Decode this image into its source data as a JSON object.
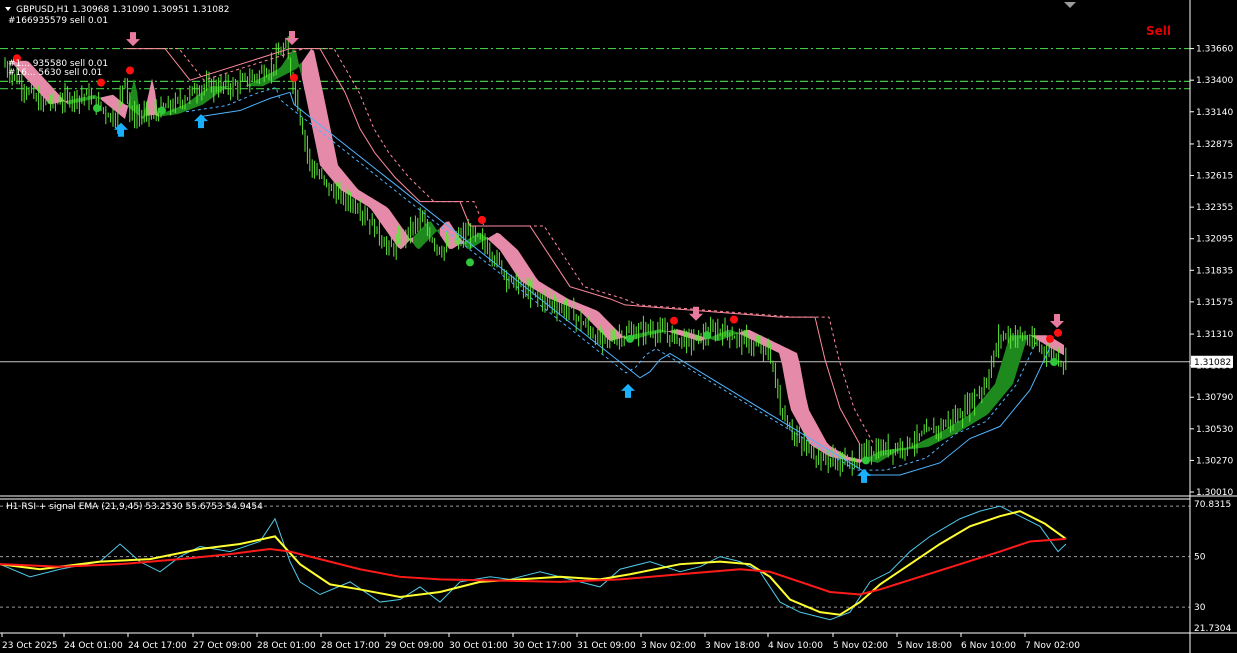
{
  "header": {
    "symbol_line": "GBPUSD,H1  1.30968 1.31090 1.30951 1.31082",
    "order_labels": [
      "#166935579 sell 0.01",
      "#1... 935580 sell 0.01",
      "#16... 5630 sell 0.01"
    ],
    "signal_text": "Sell"
  },
  "rsi_header": "H1 RSI + signal EMA (21,9,45) 53.2530 55.6753 54.9454",
  "colors": {
    "background": "#000000",
    "candle": "#5ee83a",
    "ribbon_down": "#e58aa8",
    "ribbon_up": "#1e8a1e",
    "stop_line": "#ff8ba0",
    "support_line": "#4fb4ff",
    "arrow_up": "#19b0ff",
    "arrow_down": "#e87aa0",
    "dot_red": "#ff1010",
    "dot_green": "#2ec83a",
    "dashdot": "#43c843",
    "rsi_line": "#4fc8e8",
    "rsi_signal": "#ffff30",
    "rsi_slow": "#ff1a1a",
    "current_price_line": "#c8c8c8"
  },
  "chart_data": [
    {
      "type": "candlestick",
      "title": "GBPUSD,H1",
      "ylim": [
        1.3001,
        1.3392
      ],
      "y_ticks": [
        "1.33660",
        "1.33400",
        "1.33140",
        "1.32875",
        "1.32615",
        "1.32355",
        "1.32095",
        "1.31835",
        "1.31575",
        "1.31310",
        "1.31050",
        "1.30790",
        "1.30530",
        "1.30270",
        "1.30010"
      ],
      "current_price": "1.31082",
      "x_ticks": [
        "23 Oct 2025",
        "24 Oct 01:00",
        "24 Oct 17:00",
        "27 Oct 09:00",
        "28 Oct 01:00",
        "28 Oct 17:00",
        "29 Oct 09:00",
        "30 Oct 01:00",
        "30 Oct 17:00",
        "31 Oct 09:00",
        "3 Nov 02:00",
        "3 Nov 18:00",
        "4 Nov 10:00",
        "5 Nov 02:00",
        "5 Nov 18:00",
        "6 Nov 10:00",
        "7 Nov 02:00"
      ],
      "close_path": [
        [
          0,
          1.3356
        ],
        [
          40,
          1.332
        ],
        [
          85,
          1.3328
        ],
        [
          115,
          1.3308
        ],
        [
          125,
          1.3345
        ],
        [
          130,
          1.331
        ],
        [
          150,
          1.3312
        ],
        [
          175,
          1.332
        ],
        [
          200,
          1.3335
        ],
        [
          235,
          1.3335
        ],
        [
          270,
          1.335
        ],
        [
          285,
          1.3368
        ],
        [
          295,
          1.333
        ],
        [
          310,
          1.327
        ],
        [
          330,
          1.325
        ],
        [
          360,
          1.3235
        ],
        [
          390,
          1.32
        ],
        [
          420,
          1.3225
        ],
        [
          440,
          1.32
        ],
        [
          470,
          1.3215
        ],
        [
          490,
          1.32
        ],
        [
          510,
          1.3175
        ],
        [
          540,
          1.316
        ],
        [
          570,
          1.315
        ],
        [
          600,
          1.3125
        ],
        [
          620,
          1.313
        ],
        [
          650,
          1.3135
        ],
        [
          690,
          1.3125
        ],
        [
          720,
          1.3135
        ],
        [
          745,
          1.3125
        ],
        [
          770,
          1.3115
        ],
        [
          780,
          1.307
        ],
        [
          800,
          1.304
        ],
        [
          820,
          1.303
        ],
        [
          850,
          1.3025
        ],
        [
          870,
          1.3035
        ],
        [
          900,
          1.3038
        ],
        [
          930,
          1.305
        ],
        [
          960,
          1.3065
        ],
        [
          985,
          1.309
        ],
        [
          1000,
          1.313
        ],
        [
          1020,
          1.313
        ],
        [
          1040,
          1.312
        ],
        [
          1066,
          1.3108
        ]
      ],
      "resistance_path": [
        [
          125,
          1.3366
        ],
        [
          165,
          1.3366
        ],
        [
          190,
          1.334
        ],
        [
          290,
          1.3366
        ],
        [
          320,
          1.3366
        ],
        [
          345,
          1.333
        ],
        [
          360,
          1.33
        ],
        [
          375,
          1.328
        ],
        [
          395,
          1.326
        ],
        [
          420,
          1.324
        ],
        [
          460,
          1.324
        ],
        [
          470,
          1.322
        ],
        [
          530,
          1.322
        ],
        [
          550,
          1.3195
        ],
        [
          570,
          1.317
        ],
        [
          610,
          1.316
        ],
        [
          625,
          1.3155
        ],
        [
          780,
          1.3145
        ],
        [
          815,
          1.3145
        ],
        [
          825,
          1.311
        ],
        [
          840,
          1.307
        ],
        [
          860,
          1.304
        ]
      ],
      "support_path": [
        [
          200,
          1.331
        ],
        [
          240,
          1.3315
        ],
        [
          270,
          1.3325
        ],
        [
          290,
          1.333
        ],
        [
          294,
          1.332
        ],
        [
          640,
          1.3095
        ],
        [
          650,
          1.31
        ],
        [
          660,
          1.311
        ],
        [
          670,
          1.3115
        ],
        [
          870,
          1.3015
        ],
        [
          900,
          1.3015
        ],
        [
          940,
          1.3025
        ],
        [
          970,
          1.3045
        ],
        [
          1000,
          1.3055
        ],
        [
          1030,
          1.3085
        ],
        [
          1050,
          1.312
        ]
      ],
      "signals": {
        "arrows_up": [
          [
            121,
            1.3305
          ],
          [
            201,
            1.3312
          ],
          [
            628,
            1.309
          ],
          [
            864,
            1.302
          ]
        ],
        "arrows_down": [
          [
            133,
            1.3368
          ],
          [
            292,
            1.3369
          ],
          [
            696,
            1.3142
          ],
          [
            1057,
            1.3136
          ]
        ],
        "dots_red": [
          [
            17,
            1.3358
          ],
          [
            101,
            1.3338
          ],
          [
            130,
            1.3348
          ],
          [
            294,
            1.3342
          ],
          [
            482,
            1.3225
          ],
          [
            674,
            1.3142
          ],
          [
            734,
            1.3143
          ],
          [
            1050,
            1.3127
          ],
          [
            1058,
            1.3132
          ]
        ],
        "dots_green": [
          [
            97,
            1.3317
          ],
          [
            162,
            1.3315
          ],
          [
            470,
            1.319
          ],
          [
            630,
            1.3127
          ],
          [
            707,
            1.313
          ],
          [
            866,
            1.3027
          ],
          [
            1054,
            1.3108
          ]
        ]
      },
      "dashdot_levels": [
        1.3366,
        1.3339,
        1.3333
      ]
    },
    {
      "type": "line",
      "title": "H1 RSI + signal EMA (21,9,45)",
      "ylim": [
        21.7304,
        70.8315
      ],
      "y_ticks": [
        "70.8315",
        "50",
        "30",
        "21.7304"
      ],
      "levels": [
        70,
        50,
        30
      ],
      "series": [
        {
          "name": "RSI",
          "values": [
            [
              0,
              47
            ],
            [
              30,
              42
            ],
            [
              60,
              45
            ],
            [
              100,
              48
            ],
            [
              120,
              55
            ],
            [
              140,
              48
            ],
            [
              160,
              44
            ],
            [
              180,
              50
            ],
            [
              200,
              54
            ],
            [
              230,
              52
            ],
            [
              260,
              56
            ],
            [
              275,
              65
            ],
            [
              290,
              48
            ],
            [
              300,
              40
            ],
            [
              320,
              35
            ],
            [
              350,
              40
            ],
            [
              380,
              32
            ],
            [
              400,
              33
            ],
            [
              420,
              38
            ],
            [
              440,
              32
            ],
            [
              460,
              40
            ],
            [
              490,
              42
            ],
            [
              510,
              41
            ],
            [
              540,
              44
            ],
            [
              570,
              41
            ],
            [
              600,
              38
            ],
            [
              620,
              45
            ],
            [
              650,
              48
            ],
            [
              680,
              44
            ],
            [
              700,
              46
            ],
            [
              720,
              50
            ],
            [
              740,
              48
            ],
            [
              760,
              44
            ],
            [
              780,
              32
            ],
            [
              800,
              28
            ],
            [
              830,
              25
            ],
            [
              850,
              28
            ],
            [
              870,
              40
            ],
            [
              890,
              44
            ],
            [
              910,
              52
            ],
            [
              930,
              58
            ],
            [
              960,
              65
            ],
            [
              980,
              68
            ],
            [
              1000,
              70
            ],
            [
              1020,
              66
            ],
            [
              1040,
              62
            ],
            [
              1058,
              52
            ],
            [
              1066,
              55
            ]
          ]
        },
        {
          "name": "signal",
          "values": [
            [
              0,
              47
            ],
            [
              40,
              45
            ],
            [
              100,
              48
            ],
            [
              150,
              49
            ],
            [
              200,
              53
            ],
            [
              240,
              55
            ],
            [
              275,
              58
            ],
            [
              300,
              47
            ],
            [
              330,
              39
            ],
            [
              360,
              37
            ],
            [
              400,
              34
            ],
            [
              440,
              36
            ],
            [
              480,
              40
            ],
            [
              520,
              41
            ],
            [
              560,
              42
            ],
            [
              600,
              41
            ],
            [
              630,
              43
            ],
            [
              680,
              47
            ],
            [
              720,
              48
            ],
            [
              750,
              47
            ],
            [
              770,
              42
            ],
            [
              790,
              33
            ],
            [
              820,
              28
            ],
            [
              840,
              27
            ],
            [
              860,
              32
            ],
            [
              880,
              39
            ],
            [
              910,
              47
            ],
            [
              940,
              55
            ],
            [
              970,
              62
            ],
            [
              1000,
              66
            ],
            [
              1020,
              68
            ],
            [
              1045,
              63
            ],
            [
              1066,
              57
            ]
          ]
        },
        {
          "name": "slow",
          "values": [
            [
              0,
              47
            ],
            [
              60,
              46
            ],
            [
              120,
              47
            ],
            [
              180,
              49
            ],
            [
              230,
              51
            ],
            [
              270,
              53
            ],
            [
              290,
              52
            ],
            [
              320,
              49
            ],
            [
              360,
              45
            ],
            [
              400,
              42
            ],
            [
              440,
              41
            ],
            [
              500,
              40.5
            ],
            [
              560,
              40
            ],
            [
              620,
              41
            ],
            [
              680,
              43
            ],
            [
              740,
              45
            ],
            [
              770,
              44
            ],
            [
              800,
              40
            ],
            [
              830,
              36
            ],
            [
              860,
              35
            ],
            [
              880,
              37
            ],
            [
              920,
              42
            ],
            [
              960,
              47
            ],
            [
              1000,
              52
            ],
            [
              1030,
              56
            ],
            [
              1066,
              57
            ]
          ]
        }
      ]
    }
  ]
}
